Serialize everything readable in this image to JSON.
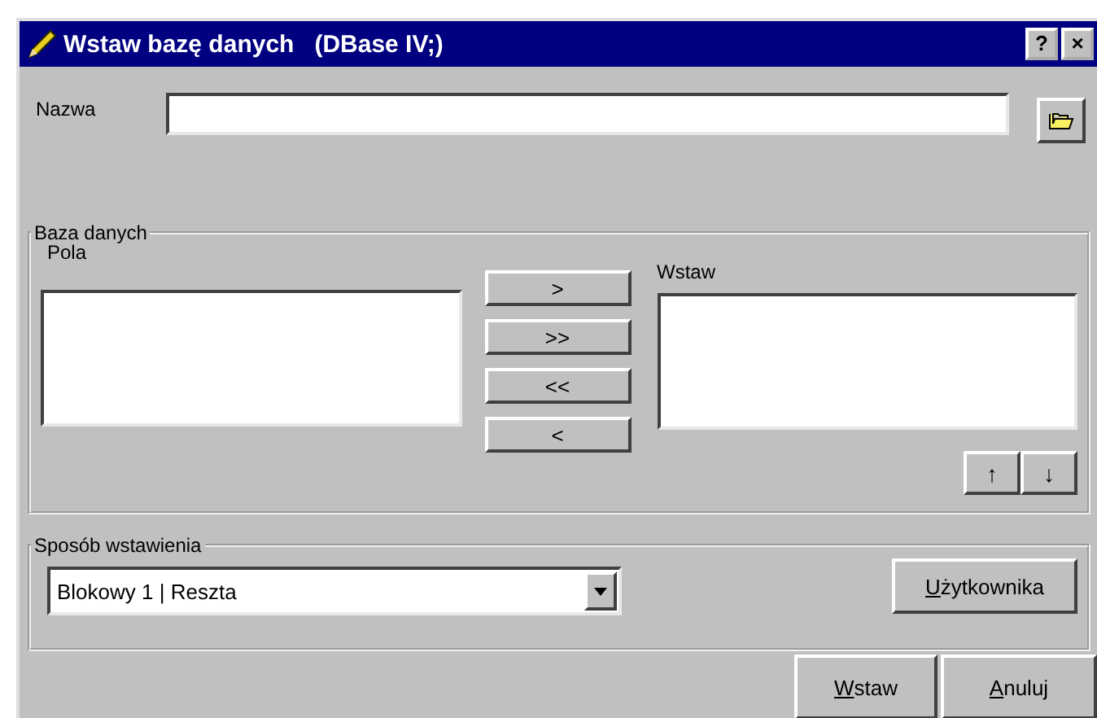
{
  "window": {
    "title": "Wstaw bazę danych   (DBase IV;)",
    "help_button": "?",
    "close_button": "×"
  },
  "name_field": {
    "label": "Nazwa"
  },
  "database_group": {
    "title": "Baza danych",
    "fields_label": "Pola",
    "insert_label": "Wstaw",
    "transfer_buttons": [
      {
        "label": ">"
      },
      {
        "label": ">>"
      },
      {
        "label": "<<"
      },
      {
        "label": "<"
      }
    ],
    "order_buttons": [
      {
        "label": "↑"
      },
      {
        "label": "↓"
      }
    ]
  },
  "insert_mode_group": {
    "title": "Sposób wstawienia",
    "combo_value": "Blokowy 1 | Reszta",
    "user_button": {
      "label": "Użytkownika",
      "underline_first": true
    }
  },
  "buttons": [
    {
      "label": "Wstaw",
      "underline_first": true
    },
    {
      "label": "Anuluj",
      "underline_first": true
    }
  ]
}
